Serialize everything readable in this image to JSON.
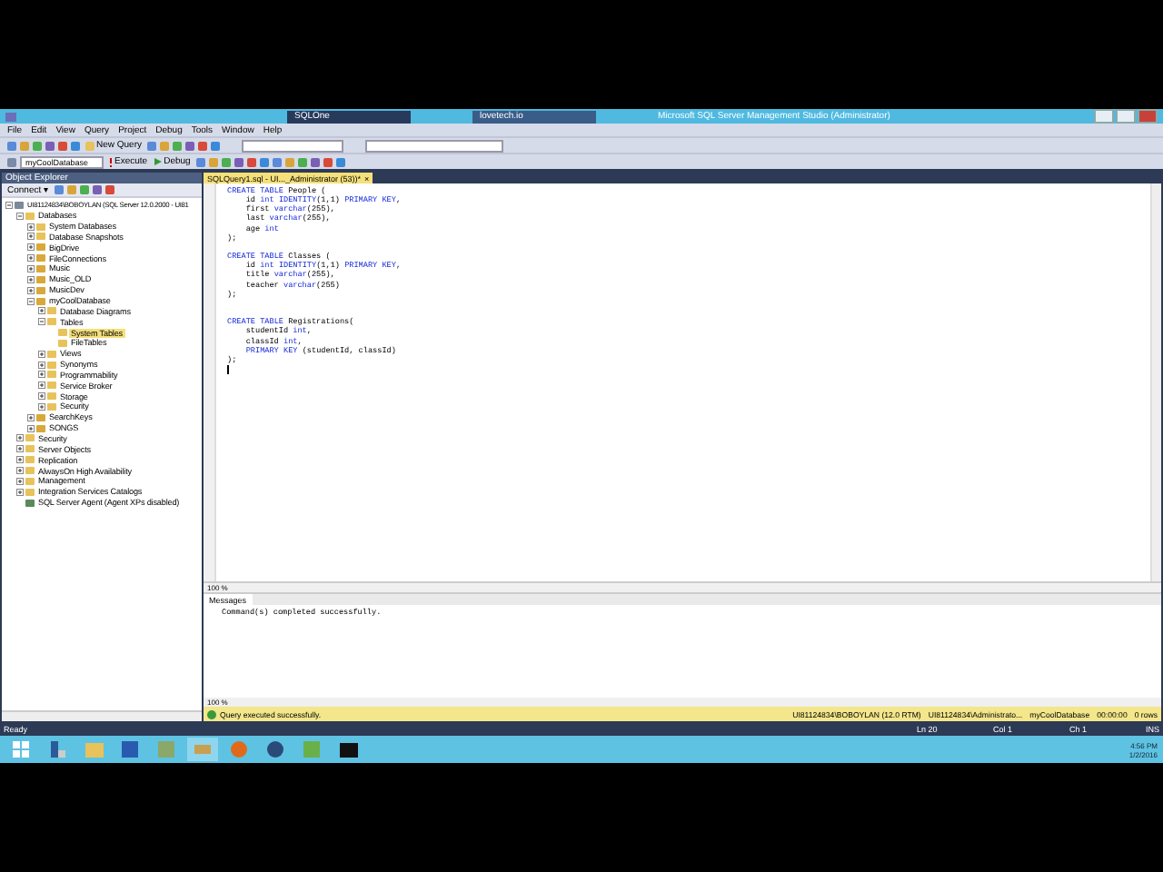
{
  "window": {
    "title": "Microsoft SQL Server Management Studio (Administrator)",
    "quick_launch": "SQLOne",
    "search_hint": "lovetech.io"
  },
  "menu": [
    "File",
    "Edit",
    "View",
    "Query",
    "Project",
    "Debug",
    "Tools",
    "Window",
    "Help"
  ],
  "toolbar": {
    "new_query": "New Query",
    "database": "myCoolDatabase",
    "execute": "Execute",
    "debug": "Debug"
  },
  "object_explorer": {
    "title": "Object Explorer",
    "connect": "Connect ▾",
    "tree": [
      {
        "label": "UI81124834\\BOBOYLAN (SQL Server 12.0.2000 - UI81",
        "kind": "server",
        "expanded": true,
        "selected": false,
        "children": [
          {
            "label": "Databases",
            "kind": "folder",
            "expanded": true,
            "selected": false,
            "children": [
              {
                "label": "System Databases",
                "kind": "folder",
                "expanded": false,
                "selected": false
              },
              {
                "label": "Database Snapshots",
                "kind": "folder",
                "expanded": false,
                "selected": false
              },
              {
                "label": "BigDrive",
                "kind": "database",
                "expanded": false,
                "selected": false
              },
              {
                "label": "FileConnections",
                "kind": "database",
                "expanded": false,
                "selected": false
              },
              {
                "label": "Music",
                "kind": "database",
                "expanded": false,
                "selected": false
              },
              {
                "label": "Music_OLD",
                "kind": "database",
                "expanded": false,
                "selected": false
              },
              {
                "label": "MusicDev",
                "kind": "database",
                "expanded": false,
                "selected": false
              },
              {
                "label": "myCoolDatabase",
                "kind": "database",
                "expanded": true,
                "selected": false,
                "children": [
                  {
                    "label": "Database Diagrams",
                    "kind": "folder",
                    "expanded": false,
                    "selected": false
                  },
                  {
                    "label": "Tables",
                    "kind": "folder",
                    "expanded": true,
                    "selected": false,
                    "children": [
                      {
                        "label": "System Tables",
                        "kind": "folder",
                        "selected": true
                      },
                      {
                        "label": "FileTables",
                        "kind": "folder",
                        "selected": false
                      }
                    ]
                  },
                  {
                    "label": "Views",
                    "kind": "folder",
                    "expanded": false,
                    "selected": false
                  },
                  {
                    "label": "Synonyms",
                    "kind": "folder",
                    "expanded": false,
                    "selected": false
                  },
                  {
                    "label": "Programmability",
                    "kind": "folder",
                    "expanded": false,
                    "selected": false
                  },
                  {
                    "label": "Service Broker",
                    "kind": "folder",
                    "expanded": false,
                    "selected": false
                  },
                  {
                    "label": "Storage",
                    "kind": "folder",
                    "expanded": false,
                    "selected": false
                  },
                  {
                    "label": "Security",
                    "kind": "folder",
                    "expanded": false,
                    "selected": false
                  }
                ]
              },
              {
                "label": "SearchKeys",
                "kind": "database",
                "expanded": false,
                "selected": false
              },
              {
                "label": "SONGS",
                "kind": "database",
                "expanded": false,
                "selected": false
              }
            ]
          },
          {
            "label": "Security",
            "kind": "folder",
            "expanded": false,
            "selected": false
          },
          {
            "label": "Server Objects",
            "kind": "folder",
            "expanded": false,
            "selected": false
          },
          {
            "label": "Replication",
            "kind": "folder",
            "expanded": false,
            "selected": false
          },
          {
            "label": "AlwaysOn High Availability",
            "kind": "folder",
            "expanded": false,
            "selected": false
          },
          {
            "label": "Management",
            "kind": "folder",
            "expanded": false,
            "selected": false
          },
          {
            "label": "Integration Services Catalogs",
            "kind": "folder",
            "expanded": false,
            "selected": false
          },
          {
            "label": "SQL Server Agent (Agent XPs disabled)",
            "kind": "agent",
            "selected": false
          }
        ]
      }
    ]
  },
  "editor": {
    "tab": "SQLQuery1.sql - UI..._Administrator (53))*",
    "tab_close": "×",
    "zoom": "100 %",
    "lines": [
      {
        "kind": "code",
        "text": "CREATE TABLE People ("
      },
      {
        "kind": "code",
        "text": "    id int IDENTITY(1,1) PRIMARY KEY,"
      },
      {
        "kind": "code",
        "text": "    first varchar(255),"
      },
      {
        "kind": "code",
        "text": "    last varchar(255),"
      },
      {
        "kind": "code",
        "text": "    age int"
      },
      {
        "kind": "code",
        "text": ");"
      },
      {
        "kind": "blank"
      },
      {
        "kind": "code",
        "text": "CREATE TABLE Classes ("
      },
      {
        "kind": "code",
        "text": "    id int IDENTITY(1,1) PRIMARY KEY,"
      },
      {
        "kind": "code",
        "text": "    title varchar(255),"
      },
      {
        "kind": "code",
        "text": "    teacher varchar(255)"
      },
      {
        "kind": "code",
        "text": ");"
      },
      {
        "kind": "blank"
      },
      {
        "kind": "blank"
      },
      {
        "kind": "code",
        "text": "CREATE TABLE Registrations("
      },
      {
        "kind": "code",
        "text": "    studentId int,"
      },
      {
        "kind": "code",
        "text": "    classId int,"
      },
      {
        "kind": "code",
        "text": "    PRIMARY KEY (studentId, classId)"
      },
      {
        "kind": "code",
        "text": ");"
      },
      {
        "kind": "cursor"
      }
    ]
  },
  "results": {
    "tab": "Messages",
    "message": "Command(s) completed successfully.",
    "zoom": "100 %"
  },
  "query_status": {
    "message": "Query executed successfully.",
    "server": "UI81124834\\BOBOYLAN (12.0 RTM)",
    "user": "UI81124834\\Administrato...",
    "database": "myCoolDatabase",
    "time": "00:00:00",
    "rows": "0 rows"
  },
  "status_bar": {
    "state": "Ready",
    "line": "Ln 20",
    "column": "Col 1",
    "char": "Ch 1",
    "mode": "INS"
  },
  "taskbar": {
    "time": "4:56 PM",
    "date": "1/2/2016"
  }
}
